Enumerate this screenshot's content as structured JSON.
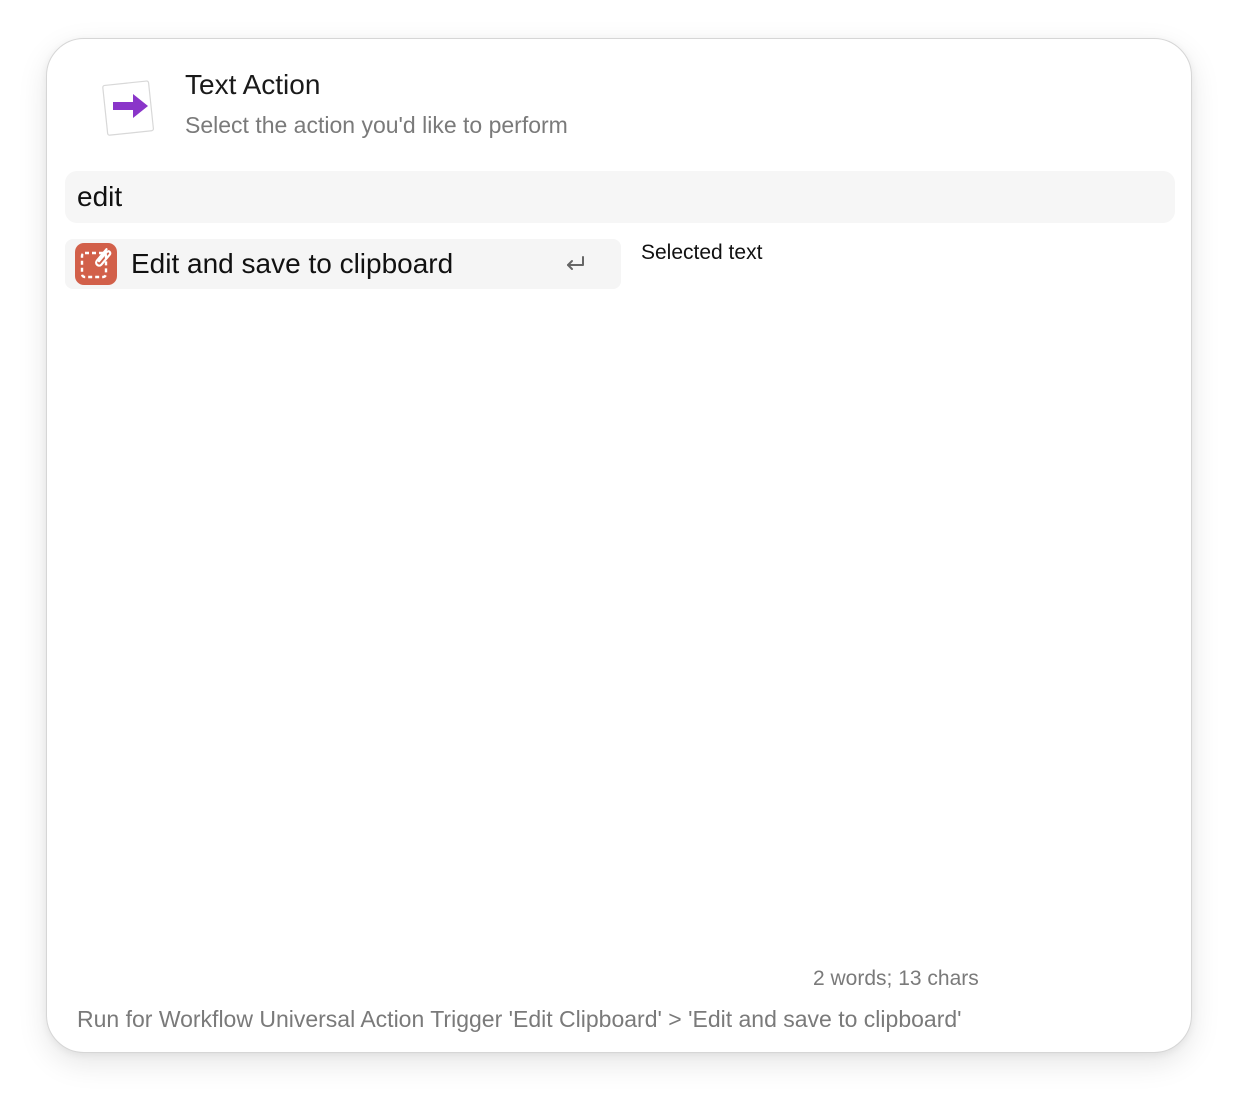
{
  "header": {
    "title": "Text Action",
    "subtitle": "Select the action you'd like to perform",
    "icon": "text-action-arrow-icon",
    "icon_color": "#8a35c9"
  },
  "search": {
    "value": "edit"
  },
  "results": [
    {
      "label": "Edit and save to clipboard",
      "icon": "clipboard-edit-icon",
      "icon_color": "#d2604a",
      "shortcut_icon": "return-key-icon"
    }
  ],
  "detail": {
    "label": "Selected text"
  },
  "status": {
    "counts": "2 words; 13 chars",
    "footer": "Run for Workflow Universal Action Trigger 'Edit Clipboard' > 'Edit and save to clipboard'"
  }
}
